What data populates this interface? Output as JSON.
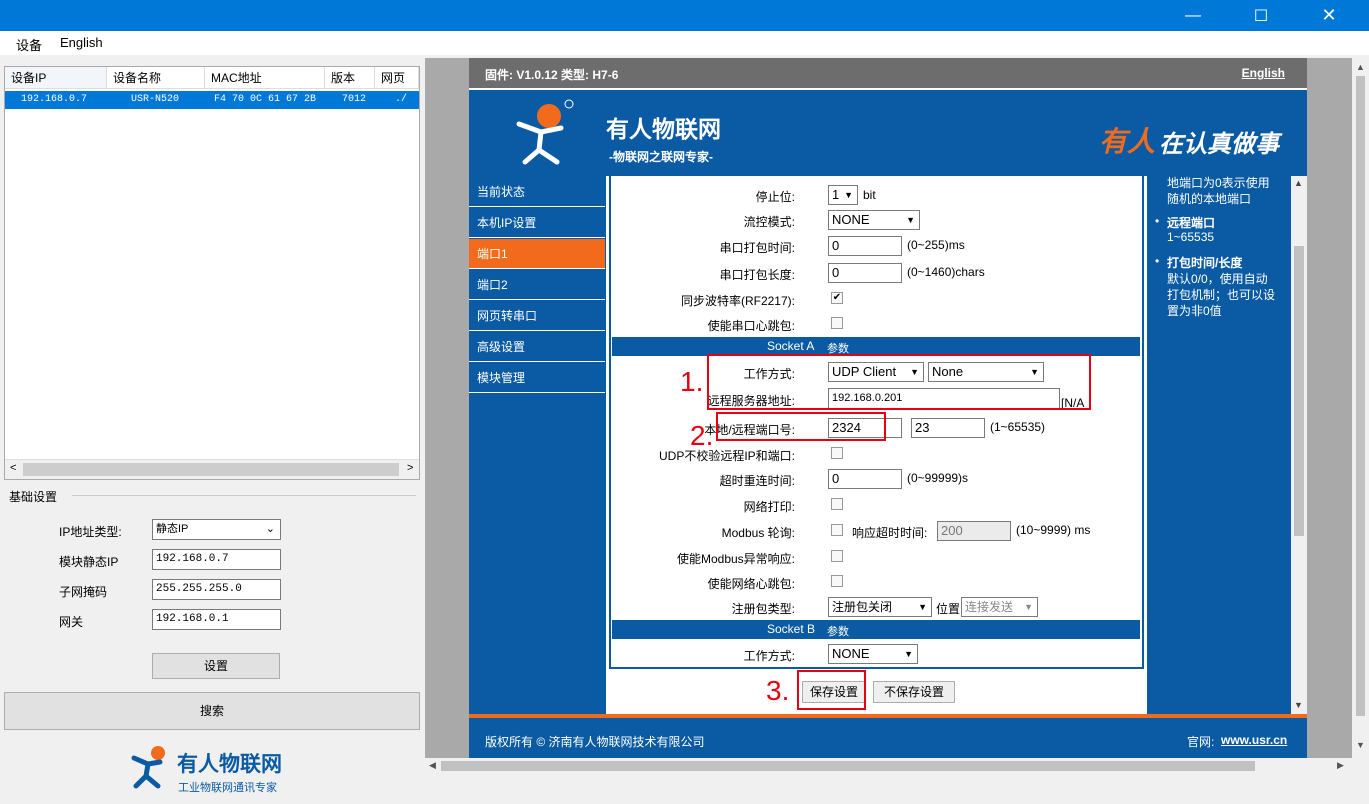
{
  "window": {
    "minimize": "—",
    "maximize": "☐",
    "close": "✕"
  },
  "menu": {
    "device": "设备",
    "english": "English"
  },
  "table": {
    "headers": [
      "设备IP",
      "设备名称",
      "MAC地址",
      "版本",
      "网页"
    ],
    "row": {
      "ip": "192.168.0.7",
      "name": "USR-N520",
      "mac": "F4 70 0C 61 67 2B",
      "version": "7012",
      "web": "./"
    }
  },
  "basic": {
    "title": "基础设置",
    "ip_type_label": "IP地址类型:",
    "ip_type_value": "静态IP",
    "static_ip_label": "模块静态IP",
    "static_ip_value": "192.168.0.7",
    "mask_label": "子网掩码",
    "mask_value": "255.255.255.0",
    "gateway_label": "网关",
    "gateway_value": "192.168.0.1",
    "set_button": "设置",
    "search_button": "搜索"
  },
  "brand": {
    "name": "有人物联网",
    "slogan": "工业物联网通讯专家"
  },
  "web": {
    "firmware": "固件: V1.0.12 类型: H7-6",
    "english_link": "English",
    "logo_name": "有人物联网",
    "logo_sub": "-物联网之联网专家-",
    "motto_red": "有人",
    "motto_white": "在认真做事",
    "nav": [
      "当前状态",
      "本机IP设置",
      "端口1",
      "端口2",
      "网页转串口",
      "高级设置",
      "模块管理"
    ],
    "nav_active_index": 2,
    "form": {
      "stop_bits_label": "停止位:",
      "stop_bits_value": "1",
      "stop_bits_unit": "bit",
      "flow_label": "流控模式:",
      "flow_value": "NONE",
      "pack_time_label": "串口打包时间:",
      "pack_time_value": "0",
      "pack_time_hint": "(0~255)ms",
      "pack_len_label": "串口打包长度:",
      "pack_len_value": "0",
      "pack_len_hint": "(0~1460)chars",
      "sync_label": "同步波特率(RF2217):",
      "heartbeat_label": "使能串口心跳包:",
      "socket_a": "Socket A",
      "socket_a_param": "参数",
      "work_mode_label": "工作方式:",
      "work_mode_value": "UDP Client",
      "work_mode_sub": "None",
      "remote_addr_label": "远程服务器地址:",
      "remote_addr_value": "192.168.0.201",
      "remote_addr_tail": "[N/A",
      "port_label": "本地/远程端口号:",
      "local_port": "2324",
      "remote_port": "23",
      "port_hint": "(1~65535)",
      "udp_label": "UDP不校验远程IP和端口:",
      "reconnect_label": "超时重连时间:",
      "reconnect_value": "0",
      "reconnect_hint": "(0~99999)s",
      "netprint_label": "网络打印:",
      "modbus_label": "Modbus 轮询:",
      "modbus_timeout_label": "响应超时时间:",
      "modbus_timeout_value": "200",
      "modbus_timeout_hint": "(10~9999) ms",
      "modbus_err_label": "使能Modbus异常响应:",
      "net_heartbeat_label": "使能网络心跳包:",
      "reg_label": "注册包类型:",
      "reg_value": "注册包关闭",
      "reg_pos_label": "位置",
      "reg_pos_value": "连接发送",
      "socket_b": "Socket B",
      "socket_b_param": "参数",
      "work_mode_b_label": "工作方式:",
      "work_mode_b_value": "NONE",
      "save_button": "保存设置",
      "nosave_button": "不保存设置"
    },
    "help": {
      "top1": "地端口为0表示使用",
      "top2": "随机的本地端口",
      "remote_port_title": "远程端口",
      "remote_port_range": "1~65535",
      "pack_title": "打包时间/长度",
      "pack_l1": "默认0/0，使用自动",
      "pack_l2": "打包机制；也可以设",
      "pack_l3": "置为非0值"
    },
    "footer": {
      "copyright": "版权所有 © 济南有人物联网技术有限公司",
      "site_label": "官网:",
      "site": "www.usr.cn"
    }
  },
  "annotations": {
    "n1": "1.",
    "n2": "2.",
    "n3": "3."
  },
  "colors": {
    "blue": "#0a5ba3",
    "orange": "#f26b1d",
    "red": "#e60012",
    "winblue": "#0078d7"
  }
}
